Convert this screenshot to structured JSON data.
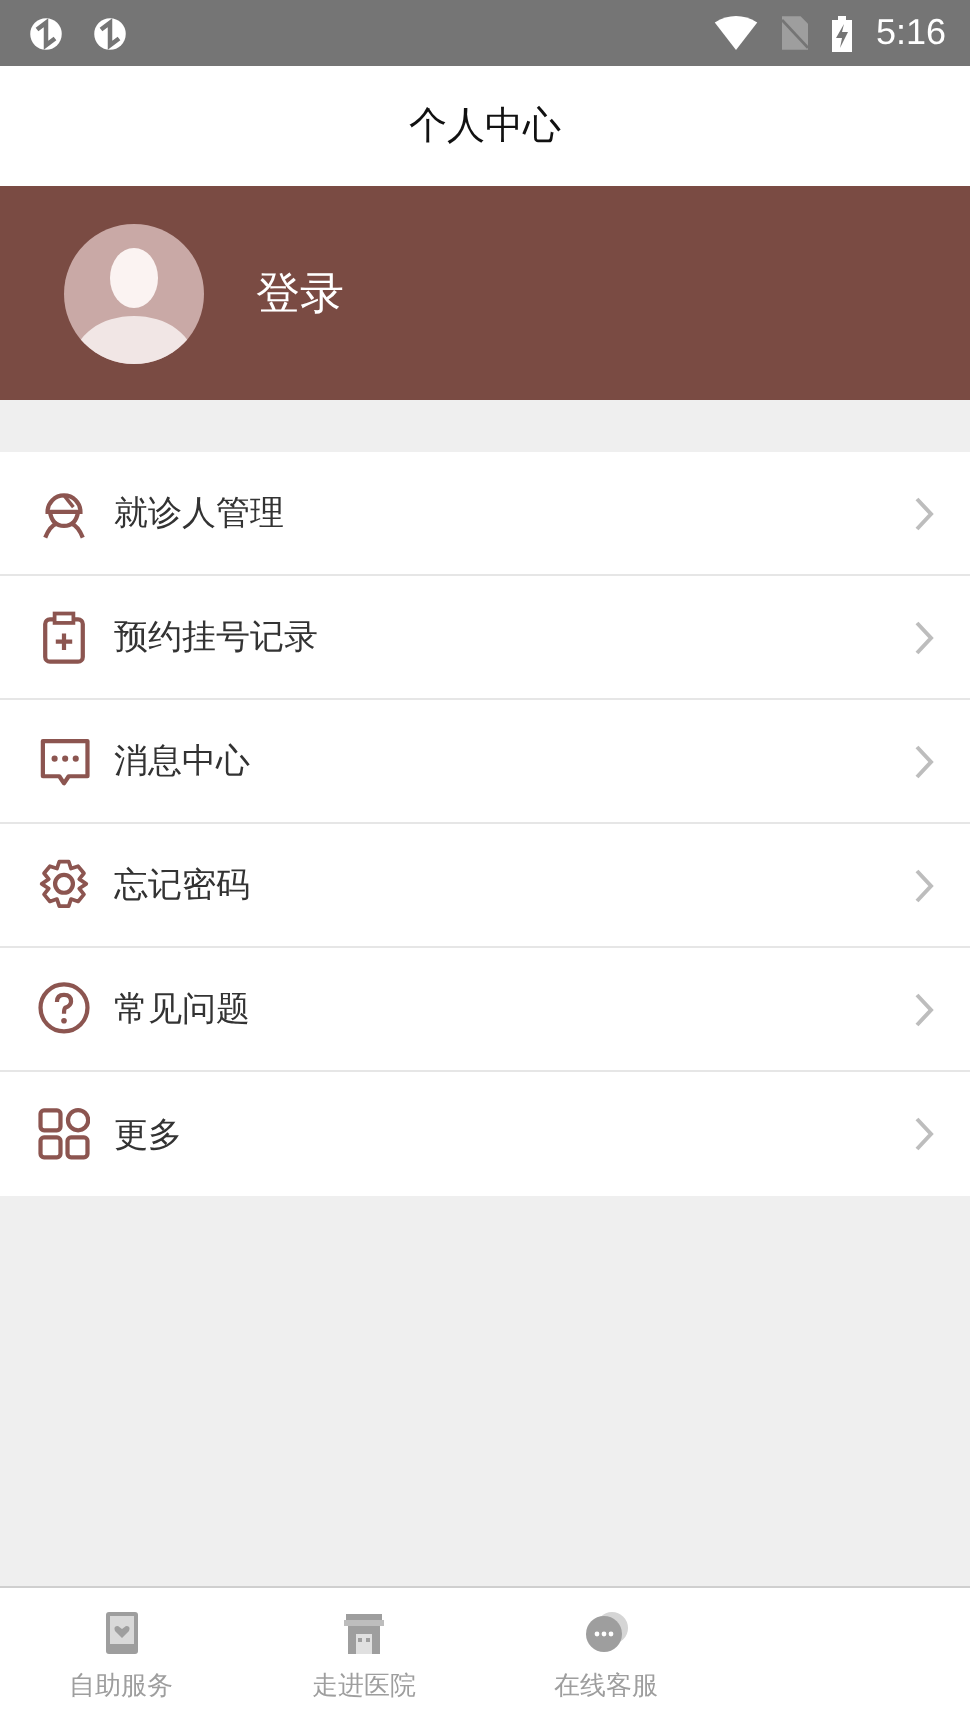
{
  "status_bar": {
    "time": "5:16"
  },
  "header": {
    "title": "个人中心"
  },
  "profile": {
    "login_label": "登录"
  },
  "menu": [
    {
      "kind": "patient",
      "label": "就诊人管理"
    },
    {
      "kind": "clipboard",
      "label": "预约挂号记录"
    },
    {
      "kind": "message",
      "label": "消息中心"
    },
    {
      "kind": "gear",
      "label": "忘记密码"
    },
    {
      "kind": "help",
      "label": "常见问题"
    },
    {
      "kind": "grid",
      "label": "更多"
    }
  ],
  "bottom_nav": [
    {
      "kind": "device",
      "label": "自助服务",
      "selected": false
    },
    {
      "kind": "building",
      "label": "走进医院",
      "selected": false
    },
    {
      "kind": "chat",
      "label": "在线客服",
      "selected": false
    }
  ]
}
